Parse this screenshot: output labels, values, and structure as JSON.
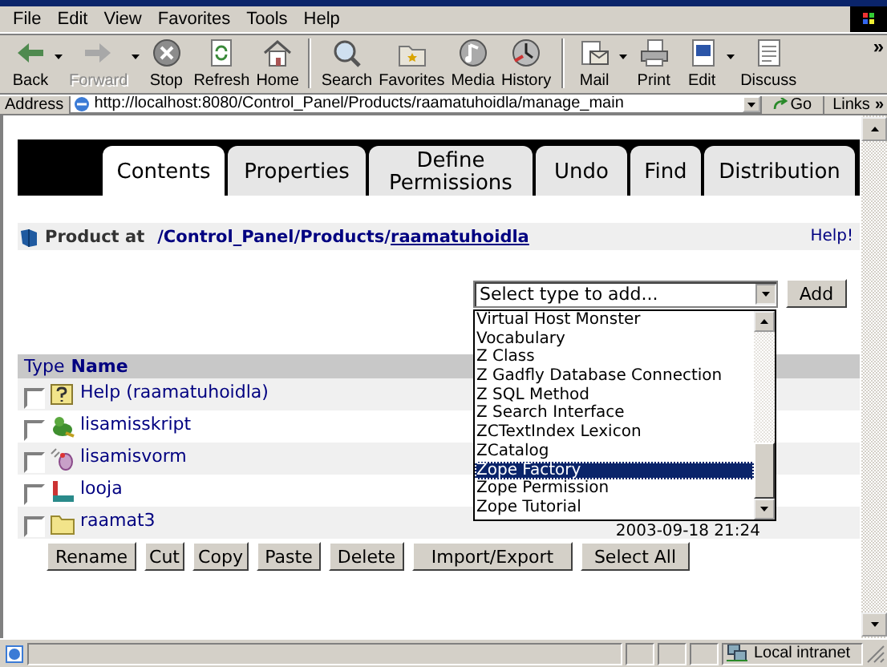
{
  "menu": [
    "File",
    "Edit",
    "View",
    "Favorites",
    "Tools",
    "Help"
  ],
  "toolbar": {
    "groups": [
      [
        {
          "label": "Back",
          "disabled": false,
          "dropdown": true
        },
        {
          "label": "Forward",
          "disabled": true,
          "dropdown": true
        },
        {
          "label": "Stop",
          "disabled": false,
          "dropdown": false
        },
        {
          "label": "Refresh",
          "disabled": false,
          "dropdown": false
        },
        {
          "label": "Home",
          "disabled": false,
          "dropdown": false
        }
      ],
      [
        {
          "label": "Search",
          "disabled": false,
          "dropdown": false
        },
        {
          "label": "Favorites",
          "disabled": false,
          "dropdown": false
        },
        {
          "label": "Media",
          "disabled": false,
          "dropdown": false
        },
        {
          "label": "History",
          "disabled": false,
          "dropdown": false
        }
      ],
      [
        {
          "label": "Mail",
          "disabled": false,
          "dropdown": true
        },
        {
          "label": "Print",
          "disabled": false,
          "dropdown": false
        },
        {
          "label": "Edit",
          "disabled": false,
          "dropdown": true
        },
        {
          "label": "Discuss",
          "disabled": false,
          "dropdown": false
        }
      ]
    ],
    "more": "»"
  },
  "address": {
    "label": "Address",
    "value": "http://localhost:8080/Control_Panel/Products/raamatuhoidla/manage_main",
    "go": "Go",
    "links": "Links",
    "more": "»"
  },
  "tabs": [
    {
      "label": "Contents",
      "selected": true
    },
    {
      "label": "Properties",
      "selected": false
    },
    {
      "label": "Define Permissions",
      "selected": false
    },
    {
      "label": "Undo",
      "selected": false
    },
    {
      "label": "Find",
      "selected": false
    },
    {
      "label": "Distribution",
      "selected": false
    }
  ],
  "product": {
    "label": "Product at",
    "path": "/Control_Panel/Products/",
    "current": "raamatuhoidla",
    "help": "Help!"
  },
  "add": {
    "value": "Select type to add...",
    "button": "Add",
    "expanded": true,
    "options": [
      {
        "label": "Virtual Host Monster",
        "selected": false
      },
      {
        "label": "Vocabulary",
        "selected": false
      },
      {
        "label": "Z Class",
        "selected": false
      },
      {
        "label": "Z Gadfly Database Connection",
        "selected": false
      },
      {
        "label": "Z SQL Method",
        "selected": false
      },
      {
        "label": "Z Search Interface",
        "selected": false
      },
      {
        "label": "ZCTextIndex Lexicon",
        "selected": false
      },
      {
        "label": "ZCatalog",
        "selected": false
      },
      {
        "label": "Zope Factory",
        "selected": true
      },
      {
        "label": "Zope Permission",
        "selected": false
      },
      {
        "label": "Zope Tutorial",
        "selected": false
      }
    ]
  },
  "table": {
    "columns": [
      "Type",
      "Name"
    ],
    "rows": [
      {
        "kind": "help",
        "name": "Help (raamatuhoidla)",
        "checked": false
      },
      {
        "kind": "script",
        "name": "lisamisskript",
        "checked": false
      },
      {
        "kind": "form",
        "name": "lisamisvorm",
        "checked": false
      },
      {
        "kind": "factory",
        "name": "looja",
        "checked": false
      },
      {
        "kind": "folder",
        "name": "raamat3",
        "checked": false,
        "column_3": "2003-09-18 21:24"
      }
    ]
  },
  "buttons": [
    "Rename",
    "Cut",
    "Copy",
    "Paste",
    "Delete",
    "Import/Export",
    "Select All"
  ],
  "status": {
    "zone": "Local intranet"
  }
}
